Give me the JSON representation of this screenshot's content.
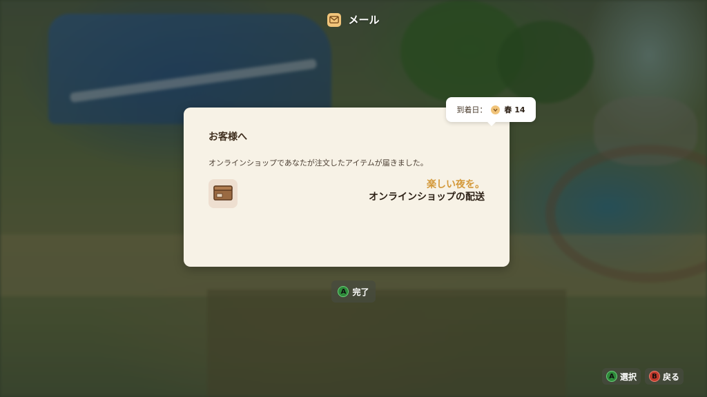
{
  "header": {
    "title": "メール",
    "icon": "mail-icon"
  },
  "letter": {
    "greeting": "お客様へ",
    "body": "オンラインショップであなたが注文したアイテムが届きました。",
    "item_icon": "package-box-icon",
    "closing_line1": "楽しい夜を。",
    "closing_line2": "オンラインショップの配送"
  },
  "arrival": {
    "label": "到着日：",
    "icon": "clock-icon",
    "value": "春 14"
  },
  "done_button": {
    "key": "A",
    "label": "完了"
  },
  "hints": {
    "select_key": "A",
    "select_label": "選択",
    "back_key": "B",
    "back_label": "戻る"
  },
  "colors": {
    "card_bg": "#f7f2e6",
    "accent_gold": "#d49a3c",
    "text_dark": "#2e2217",
    "button_a": "#2e8a3a",
    "button_b": "#c0392b"
  }
}
